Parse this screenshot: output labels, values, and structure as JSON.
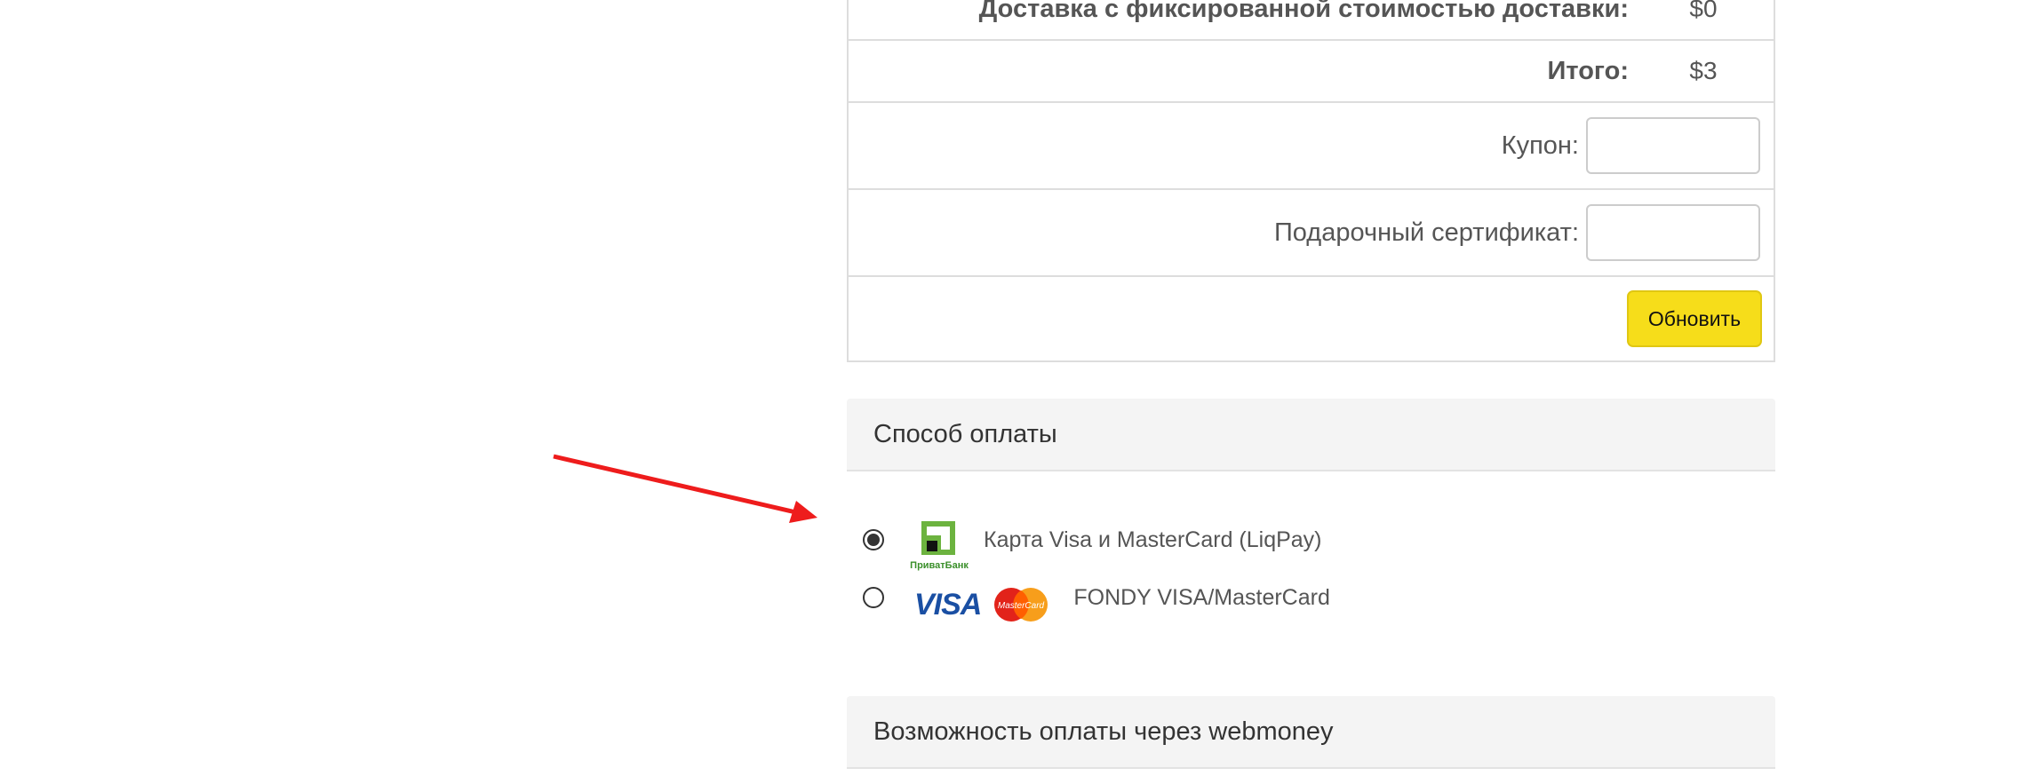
{
  "totals": {
    "shipping_label": "Доставка с фиксированной стоимостью доставки:",
    "shipping_value": "$0",
    "total_label": "Итого:",
    "total_value": "$3",
    "coupon_label": "Купон:",
    "coupon_value": "",
    "gift_label": "Подарочный сертификат:",
    "gift_value": "",
    "update_label": "Обновить"
  },
  "payment": {
    "title": "Способ оплаты",
    "methods": [
      {
        "label": "Карта Visa и MasterCard (LiqPay)",
        "logo_text": "ПриватБанк",
        "selected": true,
        "icon": "privatbank-logo-icon"
      },
      {
        "label": "FONDY VISA/MasterCard",
        "logo_text": "VISA",
        "mc_text": "MasterCard",
        "selected": false,
        "icon": "visa-mastercard-logo-icon"
      }
    ]
  },
  "webmoney": {
    "title": "Возможность оплаты через webmoney"
  },
  "colors": {
    "update_button": "#f6dd1a",
    "arrow": "#ee1c1c",
    "privat_green": "#6cb33f",
    "visa_blue": "#1a4fa3"
  }
}
